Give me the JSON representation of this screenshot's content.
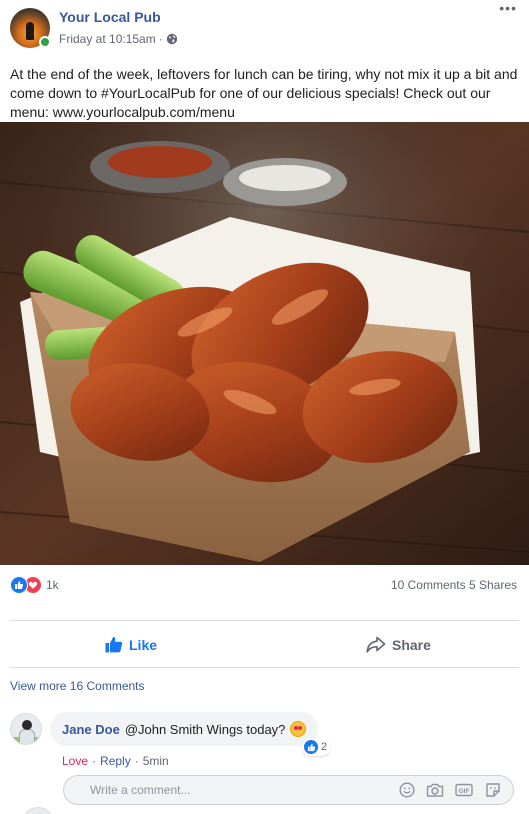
{
  "post": {
    "page_name": "Your Local Pub",
    "time": "Friday at 10:15am",
    "text": "At the end of the week, leftovers for lunch can be tiring, why not mix it up a bit and come down to #YourLocalPub for one of our delicious specials! Check out our menu: www.yourlocalpub.com/menu"
  },
  "stats": {
    "reaction_count": "1k",
    "comments_shares": "10 Comments 5 Shares"
  },
  "actions": {
    "like_label": "Like",
    "share_label": "Share"
  },
  "view_more": "View more 16 Comments",
  "comment": {
    "author": "Jane Doe",
    "text": "@John Smith Wings today?",
    "reaction_count": "2",
    "love_label": "Love",
    "reply_label": "Reply",
    "time": "5min",
    "separator": "·"
  },
  "composer": {
    "placeholder": "Write a comment..."
  },
  "colors": {
    "link_blue": "#385898",
    "like_blue": "#1877f2",
    "love_red": "#f33e58",
    "online_green": "#31a24c"
  }
}
